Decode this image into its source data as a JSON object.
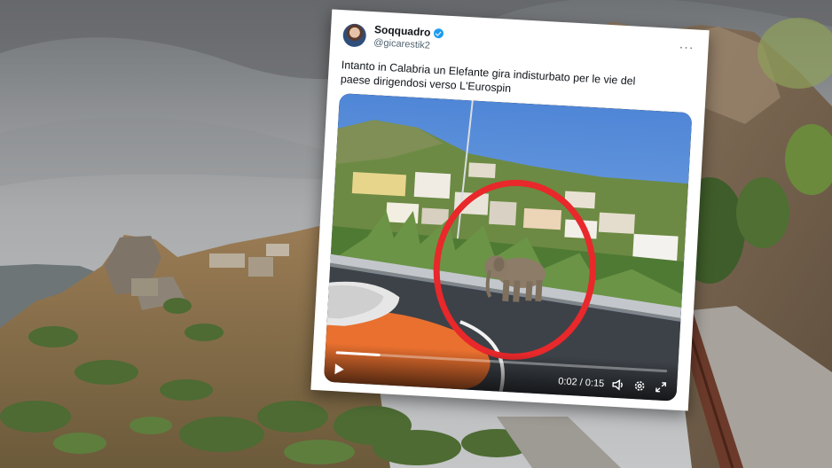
{
  "tweet": {
    "display_name": "Soqquadro",
    "handle": "@gicarestik2",
    "more_menu": "···",
    "text": "Intanto in Calabria un Elefante gira indisturbato per le vie del paese dirigendosi verso L'Eurospin"
  },
  "video": {
    "time": "0:02 / 0:15",
    "progress": 0.133,
    "highlight_color": "#e8282b"
  },
  "icons": {
    "play": "play-icon",
    "volume": "volume-icon",
    "settings": "gear-icon",
    "fullscreen": "fullscreen-icon",
    "verified": "verified-badge-icon"
  }
}
